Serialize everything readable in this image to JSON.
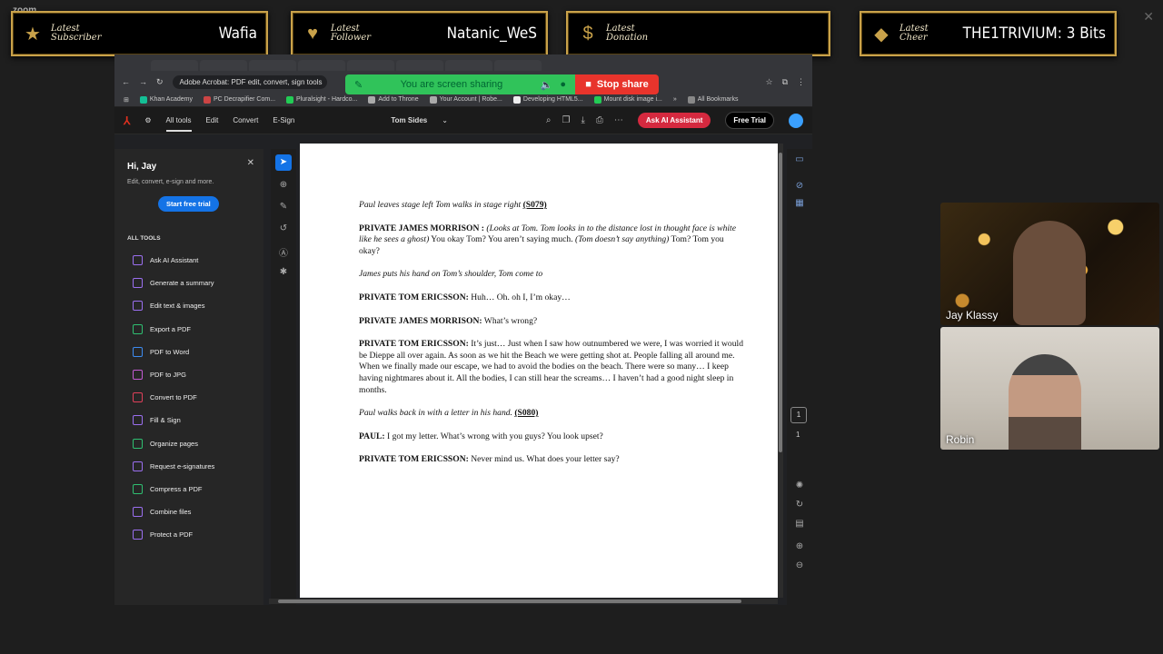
{
  "zoom_label": "zoom",
  "alerts": [
    {
      "label": "Latest Subscriber",
      "value": "Wafia",
      "icon": "star-icon"
    },
    {
      "label": "Latest Follower",
      "value": "Natanic_WeS",
      "icon": "heart-icon"
    },
    {
      "label": "Latest Donation",
      "value": "",
      "icon": "dollar-icon"
    },
    {
      "label": "Latest Cheer",
      "value": "THE1TRIVIUM: 3 Bits",
      "icon": "gem-icon"
    }
  ],
  "browser": {
    "address": "Adobe Acrobat: PDF edit, convert, sign tools",
    "bookmarks": [
      "Khan Academy",
      "PC Decrapifier Com...",
      "Pluralsight - Hardco...",
      "Add to Throne",
      "Your Account | Robe...",
      "Developing HTML5...",
      "Mount disk image i...",
      "All Bookmarks"
    ]
  },
  "share": {
    "text": "You are screen sharing",
    "stop": "Stop share"
  },
  "acrobat": {
    "tabs": [
      "All tools",
      "Edit",
      "Convert",
      "E-Sign"
    ],
    "doc_name": "Tom Sides",
    "ask_ai": "Ask AI Assistant",
    "free_trial": "Free Trial"
  },
  "panel": {
    "greeting": "Hi, Jay",
    "subtitle": "Edit, convert, e-sign and more.",
    "trial_button": "Start free trial",
    "section": "ALL TOOLS",
    "tools": [
      "Ask AI Assistant",
      "Generate a summary",
      "Edit text & images",
      "Export a PDF",
      "PDF to Word",
      "PDF to JPG",
      "Convert to PDF",
      "Fill & Sign",
      "Organize pages",
      "Request e-signatures",
      "Compress a PDF",
      "Combine files",
      "Protect a PDF"
    ]
  },
  "document": {
    "p1_i": "Paul leaves stage left Tom walks in stage right",
    "p1_u": "(S079)",
    "p2_b": "PRIVATE JAMES MORRISON :",
    "p2_i1": "(Looks at Tom.  Tom looks in to the distance lost in thought face is white like he sees a ghost)",
    "p2_t1": " You okay Tom?  You aren’t saying much. ",
    "p2_i2": "(Tom doesn’t say anything)",
    "p2_t2": " Tom?  Tom you okay?",
    "p3_i": "James puts his hand on Tom’s shoulder, Tom come to",
    "p4_b": "PRIVATE TOM ERICSSON:",
    "p4_t": "  Huh…  Oh. oh I, I’m okay…",
    "p5_b": "PRIVATE JAMES MORRISON:",
    "p5_t": "  What’s wrong?",
    "p6_b": "PRIVATE TOM ERICSSON:",
    "p6_t": "  It’s just…  Just when I saw how outnumbered we were, I was worried it would be Dieppe all over again.  As soon as we hit the Beach we were getting shot at.  People falling all around me.  When we finally made our escape, we had to avoid the bodies on the beach.  There were so many…  I keep having nightmares about it.  All the bodies, I can still hear the screams…  I haven’t had a good night sleep in months.",
    "p7_i": "Paul walks back in with a letter in his hand.",
    "p7_u": "(S080)",
    "p8_b": "PAUL:",
    "p8_t": " I got my letter.  What’s wrong with you guys?  You look upset?",
    "p9_b": "PRIVATE TOM ERICSSON:",
    "p9_t": "  Never mind us.  What does your letter say?"
  },
  "pager": {
    "current": "1",
    "total": "1"
  },
  "cams": [
    {
      "name": "Jay Klassy"
    },
    {
      "name": "Robin"
    }
  ]
}
